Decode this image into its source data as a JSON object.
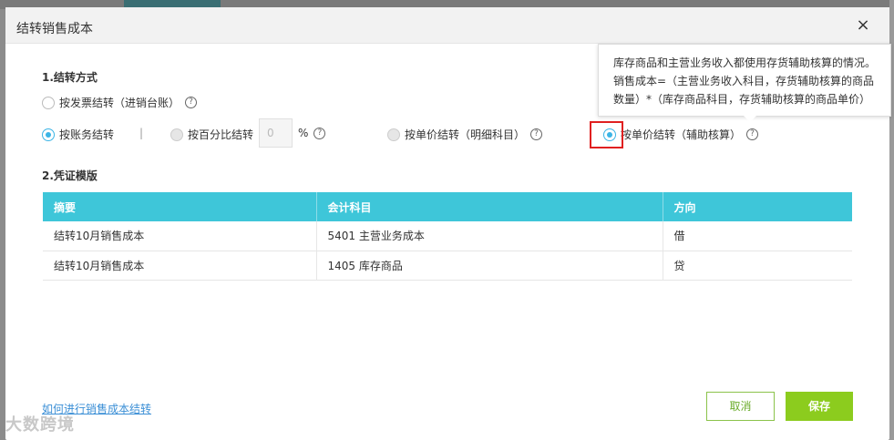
{
  "dialog": {
    "title": "结转销售成本",
    "close_icon": "×"
  },
  "section1": {
    "title": "1.结转方式",
    "options": [
      {
        "label": "按发票结转（进销台账）",
        "state": "unchecked"
      },
      {
        "label": "按账务结转",
        "state": "checked"
      },
      {
        "label": "按百分比结转",
        "state": "disabled"
      },
      {
        "label": "按单价结转（明细科目）",
        "state": "disabled"
      },
      {
        "label": "按单价结转（辅助核算）",
        "state": "checked"
      }
    ],
    "separator": "|",
    "percent_value": "0",
    "percent_sign": "%",
    "help_glyph": "?"
  },
  "tooltip": {
    "text": "库存商品和主营业务收入都使用存货辅助核算的情况。销售成本=（主营业务收入科目，存货辅助核算的商品数量）*（库存商品科目，存货辅助核算的商品单价）"
  },
  "section2": {
    "title": "2.凭证模版",
    "columns": [
      "摘要",
      "会计科目",
      "方向"
    ],
    "rows": [
      [
        "结转10月销售成本",
        "5401 主营业务成本",
        "借"
      ],
      [
        "结转10月销售成本",
        "1405 库存商品",
        "贷"
      ]
    ]
  },
  "footer": {
    "help_link": "如何进行销售成本结转",
    "cancel_label": "取消",
    "save_label": "保存"
  },
  "watermark": "大数跨境",
  "colors": {
    "accent": "#3ec6d9",
    "radio_checked": "#3bb4e5",
    "save_button": "#8ccc1e",
    "highlight": "#e02020"
  }
}
